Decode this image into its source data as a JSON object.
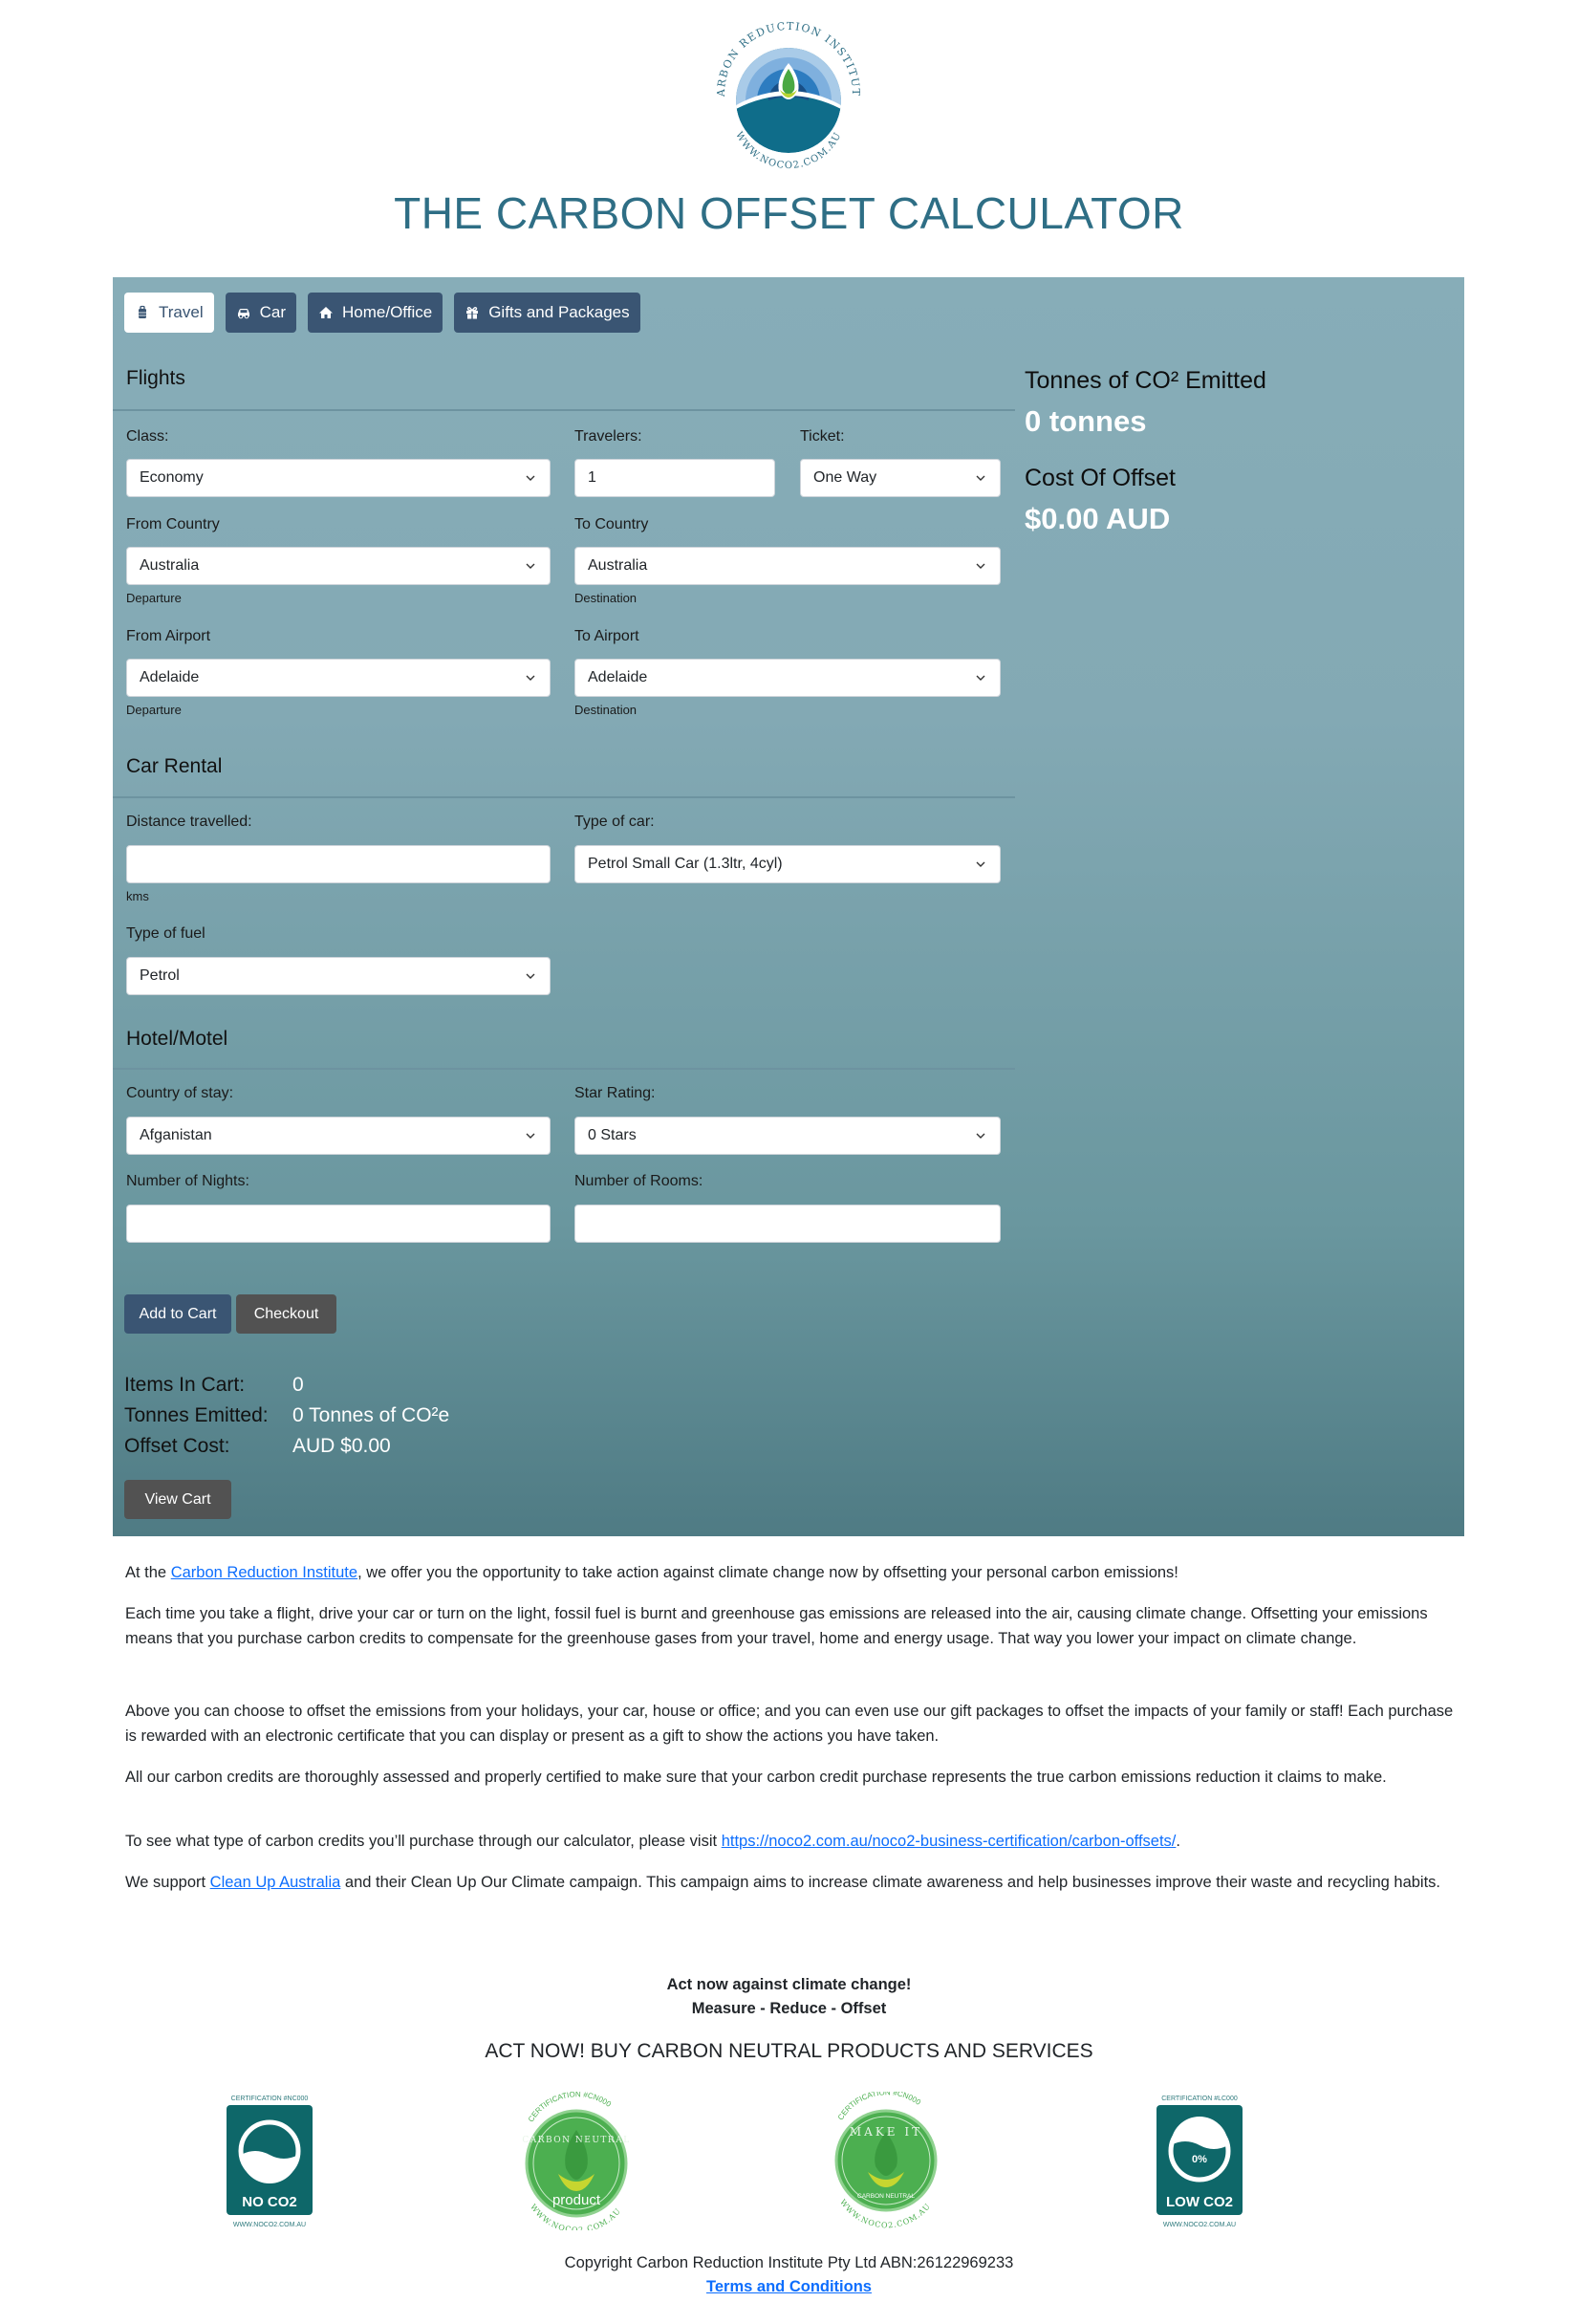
{
  "header": {
    "logo": {
      "top_text": "CARBON REDUCTION INSTITUTE",
      "bottom_text": "WWW.NOCO2.COM.AU"
    },
    "title": "THE CARBON OFFSET CALCULATOR"
  },
  "colors": {
    "title": "#2e6e85",
    "panel_top": "#87adb8",
    "panel_bottom": "#4f7b84",
    "tab_bg": "#3a5573",
    "button_grey": "#525252",
    "link": "#0d6efd"
  },
  "tabs": [
    {
      "label": "Travel",
      "icon": "suitcase-icon",
      "active": true
    },
    {
      "label": "Car",
      "icon": "car-icon",
      "active": false
    },
    {
      "label": "Home/Office",
      "icon": "home-icon",
      "active": false
    },
    {
      "label": "Gifts and Packages",
      "icon": "gift-icon",
      "active": false
    }
  ],
  "flights": {
    "heading": "Flights",
    "class_label": "Class:",
    "class_value": "Economy",
    "travelers_label": "Travelers:",
    "travelers_value": "1",
    "ticket_label": "Ticket:",
    "ticket_value": "One Way",
    "from_country_label": "From Country",
    "from_country_value": "Australia",
    "from_country_hint": "Departure",
    "to_country_label": "To Country",
    "to_country_value": "Australia",
    "to_country_hint": "Destination",
    "from_airport_label": "From Airport",
    "from_airport_value": "Adelaide",
    "from_airport_hint": "Departure",
    "to_airport_label": "To Airport",
    "to_airport_value": "Adelaide",
    "to_airport_hint": "Destination"
  },
  "car_rental": {
    "heading": "Car Rental",
    "distance_label": "Distance travelled:",
    "distance_value": "",
    "distance_hint": "kms",
    "car_type_label": "Type of car:",
    "car_type_value": "Petrol Small Car (1.3ltr, 4cyl)",
    "fuel_label": "Type of fuel",
    "fuel_value": "Petrol"
  },
  "hotel": {
    "heading": "Hotel/Motel",
    "country_label": "Country of stay:",
    "country_value": "Afganistan",
    "star_label": "Star Rating:",
    "star_value": "0 Stars",
    "nights_label": "Number of Nights:",
    "nights_value": "",
    "rooms_label": "Number of Rooms:",
    "rooms_value": ""
  },
  "summary": {
    "emitted_label": "Tonnes of CO² Emitted",
    "emitted_value": "0 tonnes",
    "cost_label": "Cost Of Offset",
    "cost_value": "$0.00 AUD"
  },
  "actions": {
    "add_to_cart": "Add to Cart",
    "checkout": "Checkout",
    "view_cart": "View Cart"
  },
  "cart": {
    "items_label": "Items In Cart:",
    "items_value": "0",
    "tonnes_label": "Tonnes Emitted:",
    "tonnes_value": "0 Tonnes of CO²e",
    "cost_label": "Offset Cost:",
    "cost_value": "AUD $0.00"
  },
  "content": {
    "p1_pre": "At the ",
    "p1_link": "Carbon Reduction Institute",
    "p1_post": ", we offer you the opportunity to take action against climate change now by offsetting your personal carbon emissions!",
    "p2": "Each time you take a flight, drive your car or turn on the light, fossil fuel is burnt and greenhouse gas emissions are released into the air, causing climate change. Offsetting your emissions means that you purchase carbon credits to compensate for the greenhouse gases from your travel, home and energy usage. That way you lower your impact on climate change.",
    "p3": "Above you can choose to offset the emissions from your holidays, your car, house or office; and you can even use our gift packages to offset the impacts of your family or staff! Each purchase is rewarded with an electronic certificate that you can display or present as a gift to show the actions you have taken.",
    "p4": "All our carbon credits are thoroughly assessed and properly certified to make sure that your carbon credit purchase represents the true carbon emissions reduction it claims to make.",
    "p5_pre": "To see what type of carbon credits you’ll purchase through our calculator, please visit ",
    "p5_link": "https://noco2.com.au/noco2-business-certification/carbon-offsets/",
    "p5_post": ".",
    "p6_pre": "We support ",
    "p6_link": "Clean Up Australia",
    "p6_post": " and their Clean Up Our Climate campaign. This campaign aims to increase climate awareness and help businesses improve their waste and recycling habits."
  },
  "cta": {
    "line1": "Act now against climate change!",
    "line2": "Measure - Reduce - Offset",
    "line3": "ACT NOW! BUY CARBON NEUTRAL PRODUCTS AND SERVICES"
  },
  "badges": [
    {
      "cert": "CERTIFICATION #NC000",
      "name": "NO CO2",
      "url": "WWW.NOCO2.COM.AU"
    },
    {
      "cert": "CERTIFICATION #CN000",
      "ring": "CARBON NEUTRAL",
      "name": "product",
      "url": "WWW.NOCO2.COM.AU"
    },
    {
      "cert": "CERTIFICATION #CN000",
      "ring": "MAKE IT",
      "name": "CARBON NEUTRAL",
      "url": "WWW.NOCO2.COM.AU"
    },
    {
      "cert": "CERTIFICATION #LC000",
      "pct": "0%",
      "name": "LOW CO2",
      "url": "WWW.NOCO2.COM.AU"
    }
  ],
  "footer": {
    "copyright": "Copyright Carbon Reduction Institute Pty Ltd ABN:26122969233",
    "terms": "Terms and Conditions"
  }
}
